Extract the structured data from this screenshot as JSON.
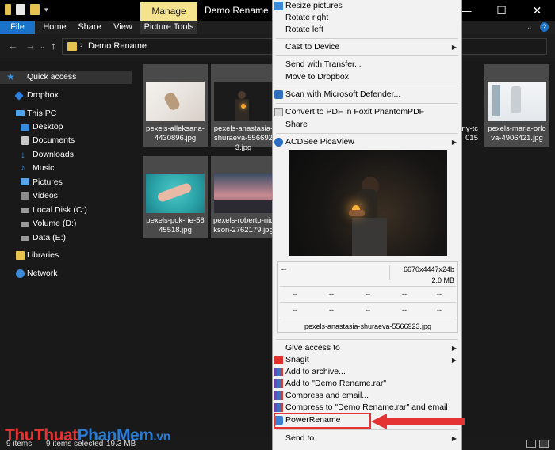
{
  "titlebar": {
    "manage_tab": "Manage",
    "title": "Demo Rename",
    "minimize": "—",
    "maximize": "☐",
    "close": "✕"
  },
  "ribbon": {
    "tabs": [
      "File",
      "Home",
      "Share",
      "View",
      "Picture Tools"
    ],
    "help": "?"
  },
  "address": {
    "back": "←",
    "forward": "→",
    "up": "↑",
    "chevron": "›",
    "path": "Demo Rename"
  },
  "nav": [
    {
      "label": "Quick access",
      "icon": "star-icon",
      "color": "#3a8fde"
    },
    {
      "label": "Dropbox",
      "icon": "dropbox-icon",
      "color": "#2d7fe0"
    },
    {
      "label": "This PC",
      "icon": "computer-icon",
      "color": "#4da3e6"
    },
    {
      "label": "Desktop",
      "icon": "desktop-icon",
      "color": "#3c8bd9"
    },
    {
      "label": "Documents",
      "icon": "documents-icon",
      "color": "#c8c8c8"
    },
    {
      "label": "Downloads",
      "icon": "downloads-icon",
      "color": "#3c8bd9"
    },
    {
      "label": "Music",
      "icon": "music-icon",
      "color": "#3c8bd9"
    },
    {
      "label": "Pictures",
      "icon": "pictures-icon",
      "color": "#5aa5e8"
    },
    {
      "label": "Videos",
      "icon": "videos-icon",
      "color": "#8a8a8a"
    },
    {
      "label": "Local Disk (C:)",
      "icon": "drive-icon",
      "color": "#9a9a9a"
    },
    {
      "label": "Volume (D:)",
      "icon": "drive-icon",
      "color": "#9a9a9a"
    },
    {
      "label": "Data (E:)",
      "icon": "drive-icon",
      "color": "#9a9a9a"
    },
    {
      "label": "Libraries",
      "icon": "libraries-icon",
      "color": "#e6c250"
    },
    {
      "label": "Network",
      "icon": "network-icon",
      "color": "#3c8bd9"
    }
  ],
  "files": [
    {
      "name": "pexels-alleksana-4430896.jpg"
    },
    {
      "name": "pexels-anastasia-shuraeva-5566923.jpg"
    },
    {
      "name": "...ny-tc...015"
    },
    {
      "name": "pexels-maria-orlova-4906421.jpg"
    },
    {
      "name": "pexels-pok-rie-5645518.jpg"
    },
    {
      "name": "pexels-roberto-nickson-2762179.jpg"
    }
  ],
  "status": {
    "count": "9 items",
    "selected": "9 items selected",
    "size": "19.3 MB"
  },
  "menu": {
    "top": [
      "Resize pictures",
      "Rotate right",
      "Rotate left"
    ],
    "cast": "Cast to Device",
    "send_transfer": "Send with Transfer...",
    "move_dropbox": "Move to Dropbox",
    "defender": "Scan with Microsoft Defender...",
    "foxit": "Convert to PDF in Foxit PhantomPDF",
    "share": "Share",
    "acdsee": "ACDSee PicaView",
    "meta": {
      "top_left": "--",
      "resolution": "6670x4447x24b",
      "size": "2.0 MB",
      "dash": "--",
      "filename": "pexels-anastasia-shuraeva-5566923.jpg"
    },
    "give_access": "Give access to",
    "snagit": "Snagit",
    "add_archive": "Add to archive...",
    "add_rar": "Add to \"Demo Rename.rar\"",
    "compress_email": "Compress and email...",
    "compress_rar_email": "Compress to \"Demo Rename.rar\" and email",
    "powerrename": "PowerRename",
    "send_to": "Send to"
  },
  "watermark": {
    "part1": "ThuThuat",
    "part2": "PhanMem",
    "part3": ".vn"
  },
  "colors": {
    "accent": "#1a73c9",
    "manage": "#f4e28d",
    "highlight": "#e53232"
  }
}
